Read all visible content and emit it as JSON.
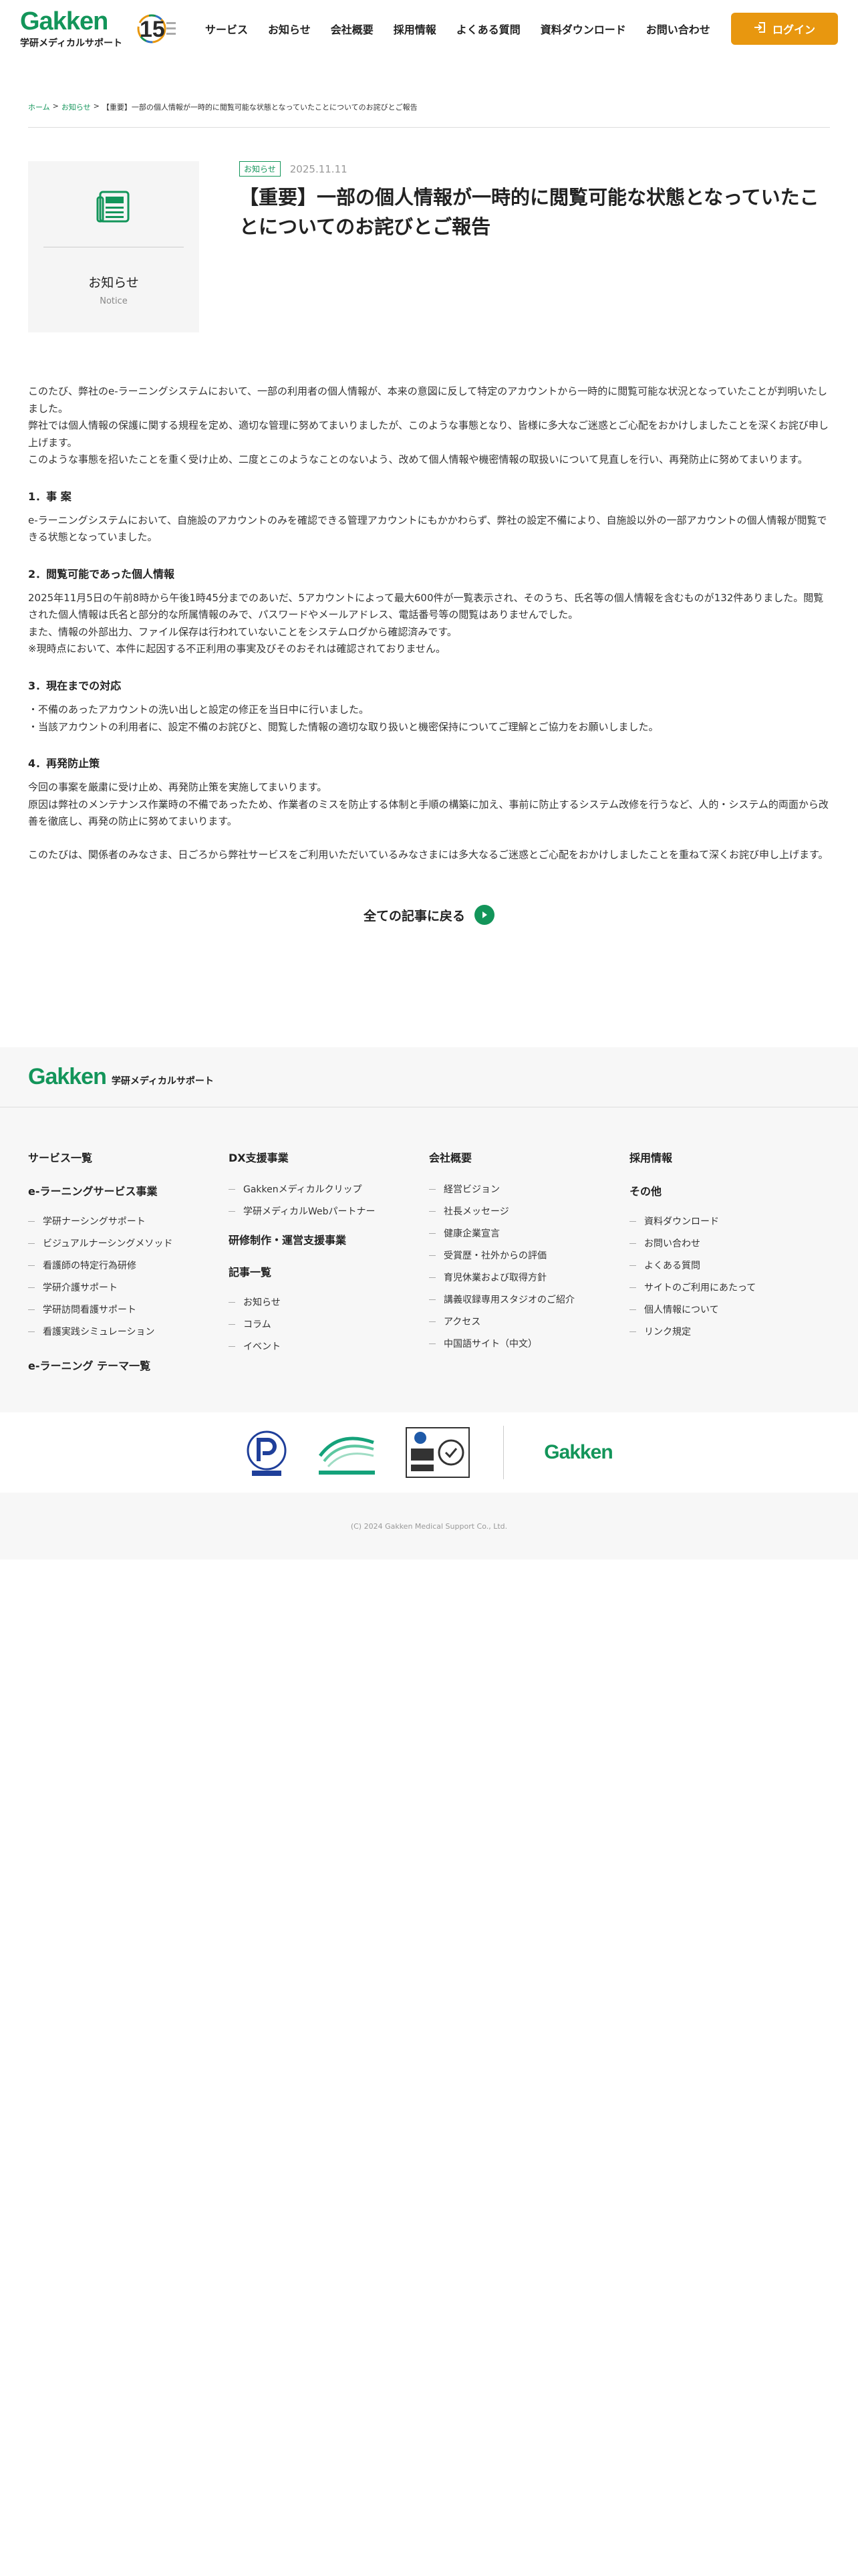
{
  "header": {
    "logo_main": "Gakken",
    "logo_sub": "学研メディカルサポート",
    "badge_text": "15",
    "nav": [
      "サービス",
      "お知らせ",
      "会社概要",
      "採用情報",
      "よくある質問",
      "資料ダウンロード",
      "お問い合わせ"
    ],
    "login_label": "ログイン"
  },
  "breadcrumb": {
    "home": "ホーム",
    "news": "お知らせ",
    "current": "【重要】一部の個人情報が一時的に閲覧可能な状態となっていたことについてのお詫びとご報告",
    "sep": ">"
  },
  "category": {
    "name": "お知らせ",
    "name_en": "Notice"
  },
  "article": {
    "tag": "お知らせ",
    "date": "2025.11.11",
    "title": "【重要】一部の個人情報が一時的に閲覧可能な状態となっていたことについてのお詫びとご報告",
    "intro": [
      "このたび、弊社のe-ラーニングシステムにおいて、一部の利用者の個人情報が、本来の意図に反して特定のアカウントから一時的に閲覧可能な状況となっていたことが判明いたしました。",
      "弊社では個人情報の保護に関する規程を定め、適切な管理に努めてまいりましたが、このような事態となり、皆様に多大なご迷惑とご心配をおかけしましたことを深くお詫び申し上げます。",
      "このような事態を招いたことを重く受け止め、二度とこのようなことのないよう、改めて個人情報や機密情報の取扱いについて見直しを行い、再発防止に努めてまいります。"
    ],
    "s1_title": "1．事 案",
    "s1_body": [
      "e-ラーニングシステムにおいて、自施設のアカウントのみを確認できる管理アカウントにもかかわらず、弊社の設定不備により、自施設以外の一部アカウントの個人情報が閲覧できる状態となっていました。"
    ],
    "s2_title": "2．閲覧可能であった個人情報",
    "s2_body": [
      "2025年11月5日の午前8時から午後1時45分までのあいだ、5アカウントによって最大600件が一覧表示され、そのうち、氏名等の個人情報を含むものが132件ありました。閲覧された個人情報は氏名と部分的な所属情報のみで、パスワードやメールアドレス、電話番号等の閲覧はありませんでした。",
      "また、情報の外部出力、ファイル保存は行われていないことをシステムログから確認済みです。",
      "※現時点において、本件に起因する不正利用の事実及びそのおそれは確認されておりません。"
    ],
    "s3_title": "3．現在までの対応",
    "s3_body": [
      "・不備のあったアカウントの洗い出しと設定の修正を当日中に行いました。",
      "・当該アカウントの利用者に、設定不備のお詫びと、閲覧した情報の適切な取り扱いと機密保持についてご理解とご協力をお願いしました。"
    ],
    "s4_title": "4．再発防止策",
    "s4_body": [
      "今回の事案を厳粛に受け止め、再発防止策を実施してまいります。",
      "原因は弊社のメンテナンス作業時の不備であったため、作業者のミスを防止する体制と手順の構築に加え、事前に防止するシステム改修を行うなど、人的・システム的両面から改善を徹底し、再発の防止に努めてまいります。"
    ],
    "closing": "このたびは、関係者のみなさま、日ごろから弊社サービスをご利用いただいているみなさまには多大なるご迷惑とご心配をおかけしましたことを重ねて深くお詫び申し上げます。",
    "back_label": "全ての記事に戻る"
  },
  "footer": {
    "logo_main": "Gakken",
    "logo_sub": "学研メディカルサポート",
    "col1": {
      "head": "サービス一覧",
      "sub1": "e-ラーニングサービス事業",
      "items": [
        "学研ナーシングサポート",
        "ビジュアルナーシングメソッド",
        "看護師の特定行為研修",
        "学研介護サポート",
        "学研訪問看護サポート",
        "看護実践シミュレーション"
      ],
      "sub2": "e-ラーニング テーマ一覧"
    },
    "col2": {
      "head": "DX支援事業",
      "items": [
        "Gakkenメディカルクリップ",
        "学研メディカルWebパートナー"
      ],
      "sub1": "研修制作・運営支援事業",
      "sub2": "記事一覧",
      "items2": [
        "お知らせ",
        "コラム",
        "イベント"
      ]
    },
    "col3": {
      "head": "会社概要",
      "items": [
        "経営ビジョン",
        "社長メッセージ",
        "健康企業宣言",
        "受賞歴・社外からの評価",
        "育児休業および取得方針",
        "講義収録専用スタジオのご紹介",
        "アクセス",
        "中国語サイト（中文）"
      ]
    },
    "col4": {
      "head": "採用情報",
      "sub1": "その他",
      "items": [
        "資料ダウンロード",
        "お問い合わせ",
        "よくある質問",
        "サイトのご利用にあたって",
        "個人情報について",
        "リンク規定"
      ]
    },
    "gakken_mark": "Gakken",
    "copyright": "(C) 2024 Gakken Medical Support Co., Ltd."
  }
}
